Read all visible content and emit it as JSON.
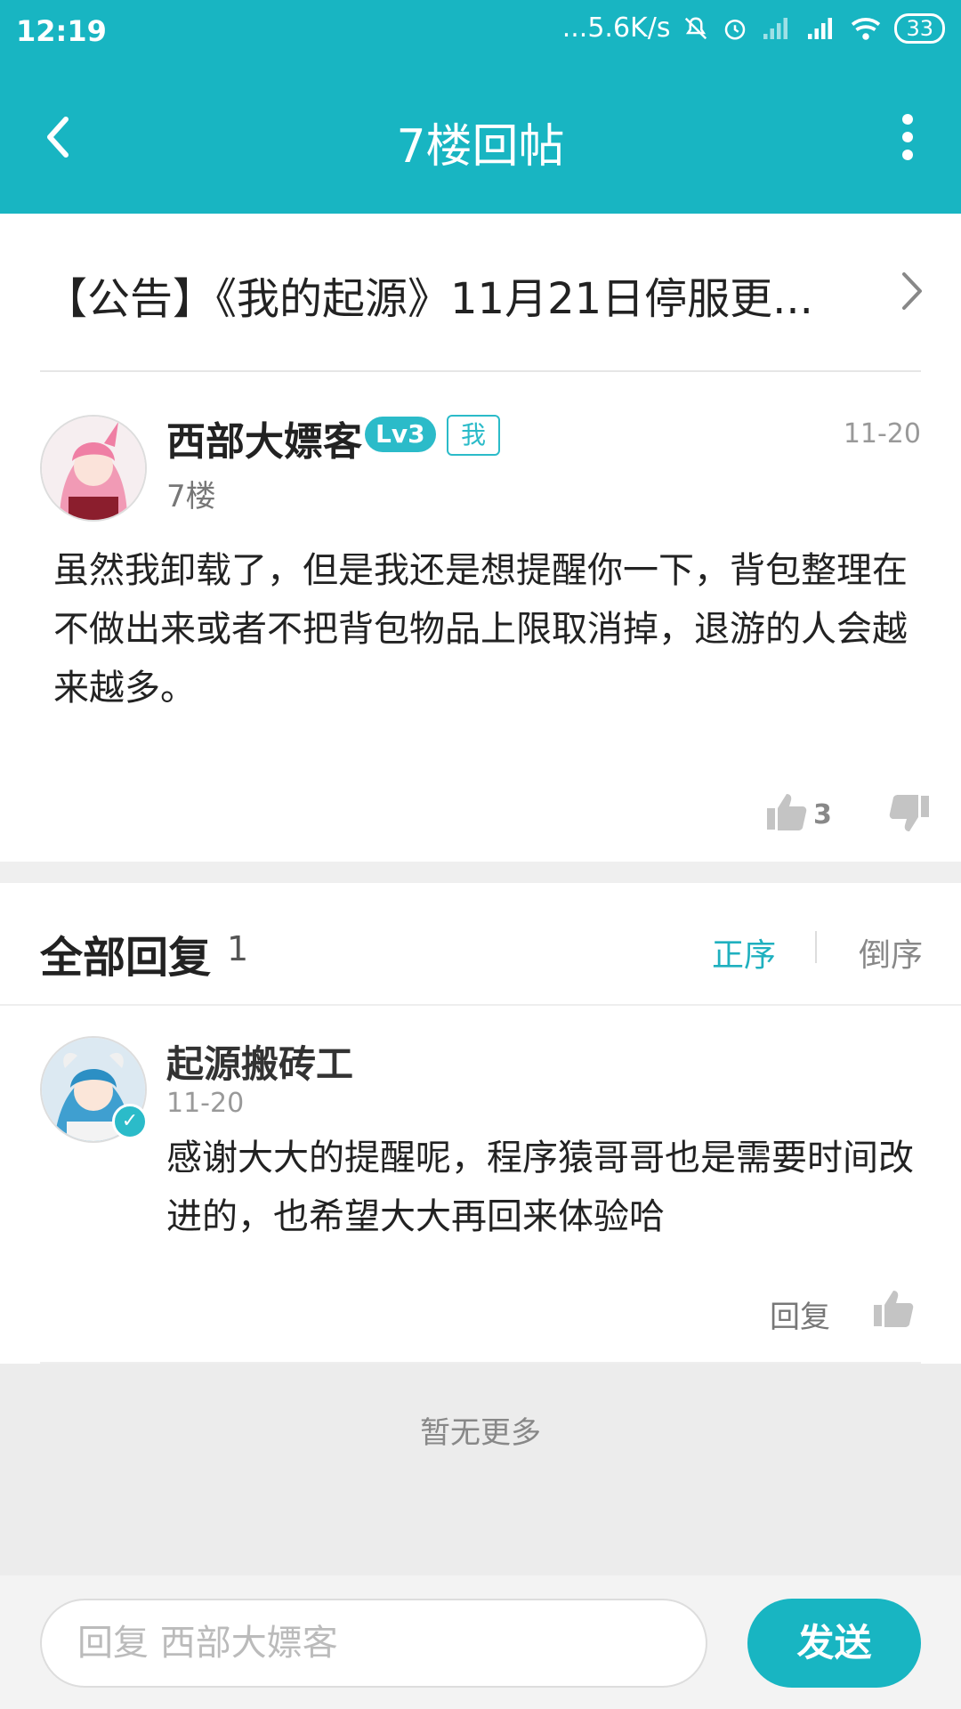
{
  "status_bar": {
    "time": "12:19",
    "network_speed": "...5.6K/s",
    "battery": "33"
  },
  "app_bar": {
    "title": "7楼回帖"
  },
  "notice": {
    "text": "【公告】《我的起源》11月21日停服更..."
  },
  "post": {
    "username": "西部大嫖客",
    "level": "Lv3",
    "self_badge": "我",
    "floor": "7楼",
    "date": "11-20",
    "content": "虽然我卸载了，但是我还是想提醒你一下，背包整理在不做出来或者不把背包物品上限取消掉，退游的人会越来越多。",
    "like_count": "3"
  },
  "replies_section": {
    "title": "全部回复",
    "count": "1",
    "sort_asc": "正序",
    "sort_desc": "倒序"
  },
  "replies": [
    {
      "username": "起源搬砖工",
      "date": "11-20",
      "content": "感谢大大的提醒呢，程序猿哥哥也是需要时间改进的，也希望大大再回来体验哈",
      "reply_label": "回复"
    }
  ],
  "footer": {
    "no_more": "暂无更多"
  },
  "bottom_bar": {
    "input_placeholder": "回复 西部大嫖客",
    "send_label": "发送"
  },
  "colors": {
    "accent": "#18b5c2",
    "level_badge": "#2bbbc9"
  }
}
